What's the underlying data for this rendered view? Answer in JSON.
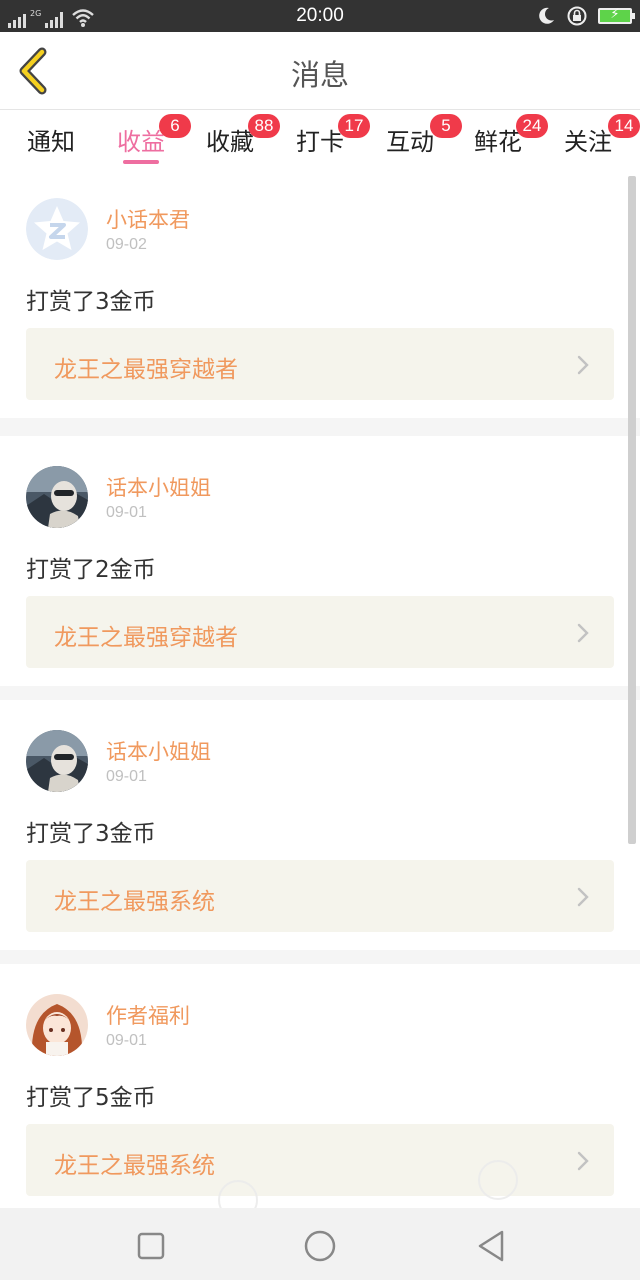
{
  "status_bar": {
    "time": "20:00",
    "signal_label": "2G",
    "battery_color": "#5ed34a"
  },
  "header": {
    "title": "消息",
    "back_icon": "chevron-left-icon",
    "accent_color": "#f5d020"
  },
  "tabs": [
    {
      "label": "通知",
      "badge": "",
      "active": false
    },
    {
      "label": "收益",
      "badge": "6",
      "active": true
    },
    {
      "label": "收藏",
      "badge": "88",
      "active": false
    },
    {
      "label": "打卡",
      "badge": "17",
      "active": false
    },
    {
      "label": "互动",
      "badge": "5",
      "active": false
    },
    {
      "label": "鲜花",
      "badge": "24",
      "active": false
    },
    {
      "label": "关注",
      "badge": "14",
      "active": false
    }
  ],
  "messages": [
    {
      "user": "小话本君",
      "date": "09-02",
      "action": "打赏了3金币",
      "book": "龙王之最强穿越者",
      "avatar": "star-logo-avatar"
    },
    {
      "user": "话本小姐姐",
      "date": "09-01",
      "action": "打赏了2金币",
      "book": "龙王之最强穿越者",
      "avatar": "photo-avatar"
    },
    {
      "user": "话本小姐姐",
      "date": "09-01",
      "action": "打赏了3金币",
      "book": "龙王之最强系统",
      "avatar": "photo-avatar"
    },
    {
      "user": "作者福利",
      "date": "09-01",
      "action": "打赏了5金币",
      "book": "龙王之最强系统",
      "avatar": "anime-girl-avatar"
    }
  ],
  "colors": {
    "active_tab": "#ee6ea0",
    "badge": "#f03a4a",
    "username": "#f0995e",
    "book_bg": "#f5f4ec"
  },
  "navbar": {
    "buttons": [
      "recent-apps-icon",
      "home-icon",
      "back-icon"
    ]
  }
}
